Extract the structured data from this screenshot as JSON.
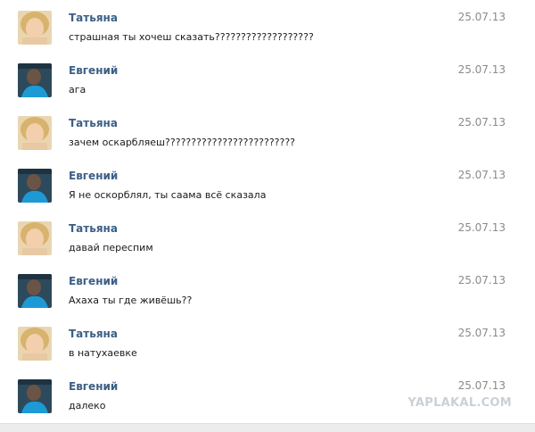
{
  "messages": [
    {
      "author": "Татьяна",
      "date": "25.07.13",
      "text": "страшная ты хочеш сказать???????????????????",
      "avatar": "female-avatar-icon"
    },
    {
      "author": "Евгений",
      "date": "25.07.13",
      "text": "ага",
      "avatar": "male-avatar-icon"
    },
    {
      "author": "Татьяна",
      "date": "25.07.13",
      "text": "зачем оскарбляеш?????????????????????????",
      "avatar": "female-avatar-icon"
    },
    {
      "author": "Евгений",
      "date": "25.07.13",
      "text": "Я не оскорблял, ты саама всё сказала",
      "avatar": "male-avatar-icon"
    },
    {
      "author": "Татьяна",
      "date": "25.07.13",
      "text": "давай переспим",
      "avatar": "female-avatar-icon"
    },
    {
      "author": "Евгений",
      "date": "25.07.13",
      "text": "Ахаха ты где живёшь??",
      "avatar": "male-avatar-icon"
    },
    {
      "author": "Татьяна",
      "date": "25.07.13",
      "text": "в натухаевке",
      "avatar": "female-avatar-icon"
    },
    {
      "author": "Евгений",
      "date": "25.07.13",
      "text": "далеко",
      "avatar": "male-avatar-icon"
    }
  ],
  "watermark": "YAPLAKAL.COM",
  "colors": {
    "author": "#3b5f86",
    "date": "#8b8b8b",
    "text": "#1a1a1a",
    "watermark": "#c9d0d8"
  }
}
